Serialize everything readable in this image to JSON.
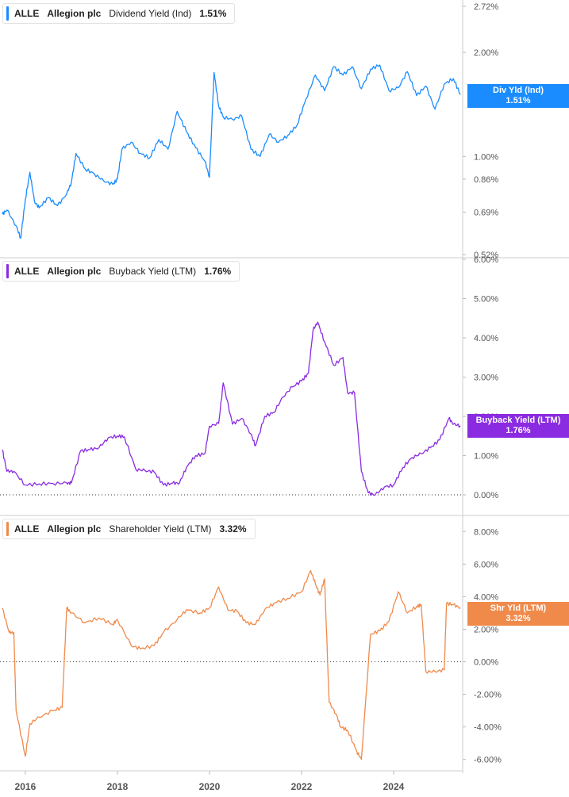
{
  "colors": {
    "dividend": "#1a8cff",
    "buyback": "#8a2be2",
    "shareholder": "#f08a4b",
    "grid": "#dddddd",
    "axis_text": "#555555"
  },
  "panels": [
    {
      "ticker": "ALLE",
      "company": "Allegion plc",
      "metric": "Dividend Yield (Ind)",
      "value": "1.51%",
      "badge_line1": "Div Yld (Ind)",
      "badge_line2": "1.51%"
    },
    {
      "ticker": "ALLE",
      "company": "Allegion plc",
      "metric": "Buyback Yield (LTM)",
      "value": "1.76%",
      "badge_line1": "Buyback Yield (LTM)",
      "badge_line2": "1.76%"
    },
    {
      "ticker": "ALLE",
      "company": "Allegion plc",
      "metric": "Shareholder Yield (LTM)",
      "value": "3.32%",
      "badge_line1": "Shr Yld (LTM)",
      "badge_line2": "3.32%"
    }
  ],
  "chart_data": [
    {
      "type": "line",
      "title": "Dividend Yield (Ind)",
      "y_scale": "log",
      "ylim": [
        0.52,
        2.72
      ],
      "y_ticks": [
        "2.72%",
        "2.00%",
        "1.00%",
        "0.86%",
        "0.69%",
        "0.52%"
      ],
      "y_tick_values": [
        2.72,
        2.0,
        1.0,
        0.86,
        0.69,
        0.52
      ],
      "series": [
        {
          "name": "Div Yld (Ind)",
          "x": [
            2015.5,
            2015.6,
            2015.8,
            2015.9,
            2016.0,
            2016.1,
            2016.2,
            2016.3,
            2016.5,
            2016.7,
            2016.9,
            2017.0,
            2017.1,
            2017.3,
            2017.5,
            2017.7,
            2017.9,
            2018.0,
            2018.1,
            2018.3,
            2018.5,
            2018.7,
            2018.9,
            2019.1,
            2019.3,
            2019.5,
            2019.7,
            2019.9,
            2020.0,
            2020.1,
            2020.2,
            2020.3,
            2020.5,
            2020.7,
            2020.9,
            2021.1,
            2021.3,
            2021.5,
            2021.7,
            2021.9,
            2022.1,
            2022.3,
            2022.5,
            2022.7,
            2022.9,
            2023.1,
            2023.3,
            2023.5,
            2023.7,
            2023.9,
            2024.1,
            2024.3,
            2024.5,
            2024.7,
            2024.9,
            2025.1,
            2025.3,
            2025.45
          ],
          "y": [
            0.68,
            0.7,
            0.63,
            0.58,
            0.75,
            0.9,
            0.74,
            0.71,
            0.76,
            0.72,
            0.78,
            0.84,
            1.02,
            0.92,
            0.89,
            0.85,
            0.83,
            0.86,
            1.05,
            1.1,
            1.02,
            0.99,
            1.12,
            1.05,
            1.35,
            1.18,
            1.06,
            0.97,
            0.87,
            1.75,
            1.4,
            1.3,
            1.28,
            1.31,
            1.05,
            1.0,
            1.16,
            1.1,
            1.15,
            1.23,
            1.47,
            1.72,
            1.55,
            1.82,
            1.72,
            1.82,
            1.57,
            1.79,
            1.84,
            1.55,
            1.58,
            1.76,
            1.5,
            1.6,
            1.37,
            1.62,
            1.68,
            1.51
          ]
        }
      ]
    },
    {
      "type": "line",
      "title": "Buyback Yield (LTM)",
      "ylim": [
        0,
        6
      ],
      "y_ticks": [
        "6.00%",
        "5.00%",
        "4.00%",
        "3.00%",
        "2.00%",
        "1.00%",
        "0.00%"
      ],
      "y_tick_values": [
        6,
        5,
        4,
        3,
        2,
        1,
        0
      ],
      "series": [
        {
          "name": "Buyback Yield (LTM)",
          "x": [
            2015.5,
            2015.6,
            2015.75,
            2016.0,
            2016.3,
            2016.6,
            2016.9,
            2017.0,
            2017.2,
            2017.4,
            2017.6,
            2017.8,
            2018.0,
            2018.15,
            2018.4,
            2018.6,
            2018.8,
            2019.0,
            2019.2,
            2019.35,
            2019.5,
            2019.7,
            2019.9,
            2020.0,
            2020.2,
            2020.3,
            2020.5,
            2020.7,
            2020.9,
            2021.0,
            2021.2,
            2021.4,
            2021.6,
            2021.8,
            2022.0,
            2022.15,
            2022.25,
            2022.35,
            2022.5,
            2022.7,
            2022.9,
            2023.0,
            2023.15,
            2023.3,
            2023.45,
            2023.6,
            2023.8,
            2024.0,
            2024.2,
            2024.4,
            2024.6,
            2024.8,
            2025.0,
            2025.2,
            2025.3,
            2025.45
          ],
          "y": [
            1.15,
            0.6,
            0.6,
            0.25,
            0.28,
            0.29,
            0.3,
            0.3,
            1.12,
            1.15,
            1.2,
            1.45,
            1.5,
            1.48,
            0.65,
            0.62,
            0.58,
            0.25,
            0.3,
            0.3,
            0.7,
            1.0,
            1.05,
            1.75,
            1.82,
            2.85,
            1.8,
            1.95,
            1.55,
            1.25,
            2.0,
            2.1,
            2.5,
            2.75,
            2.9,
            3.1,
            4.2,
            4.4,
            3.9,
            3.3,
            3.5,
            2.6,
            2.6,
            0.6,
            0.05,
            0.0,
            0.2,
            0.25,
            0.7,
            0.95,
            1.05,
            1.2,
            1.4,
            1.95,
            1.8,
            1.76
          ]
        }
      ]
    },
    {
      "type": "line",
      "title": "Shareholder Yield (LTM)",
      "ylim": [
        -6.5,
        8.5
      ],
      "y_ticks": [
        "8.00%",
        "6.00%",
        "4.00%",
        "2.00%",
        "0.00%",
        "-2.00%",
        "-4.00%",
        "-6.00%"
      ],
      "y_tick_values": [
        8,
        6,
        4,
        2,
        0,
        -2,
        -4,
        -6
      ],
      "series": [
        {
          "name": "Shr Yld (LTM)",
          "x": [
            2015.5,
            2015.65,
            2015.75,
            2015.8,
            2016.0,
            2016.1,
            2016.3,
            2016.6,
            2016.8,
            2016.9,
            2017.0,
            2017.3,
            2017.6,
            2017.9,
            2018.0,
            2018.3,
            2018.5,
            2018.8,
            2019.0,
            2019.3,
            2019.5,
            2019.8,
            2020.0,
            2020.2,
            2020.4,
            2020.6,
            2020.8,
            2021.0,
            2021.2,
            2021.4,
            2021.7,
            2022.0,
            2022.2,
            2022.3,
            2022.4,
            2022.5,
            2022.6,
            2022.75,
            2022.85,
            2023.0,
            2023.2,
            2023.3,
            2023.5,
            2023.7,
            2023.9,
            2024.1,
            2024.3,
            2024.5,
            2024.6,
            2024.7,
            2024.9,
            2025.1,
            2025.15,
            2025.3,
            2025.45
          ],
          "y": [
            3.3,
            1.8,
            1.8,
            -3.0,
            -5.8,
            -3.8,
            -3.4,
            -3.0,
            -2.8,
            3.3,
            3.0,
            2.4,
            2.7,
            2.3,
            2.6,
            1.0,
            0.8,
            1.0,
            1.8,
            2.6,
            3.2,
            3.0,
            3.3,
            4.6,
            3.2,
            3.1,
            2.4,
            2.3,
            3.2,
            3.6,
            3.9,
            4.3,
            5.6,
            4.8,
            4.1,
            5.1,
            -2.5,
            -3.2,
            -4.0,
            -4.2,
            -5.5,
            -6.0,
            1.7,
            1.9,
            2.5,
            4.3,
            3.0,
            3.4,
            3.5,
            -0.6,
            -0.6,
            -0.5,
            3.6,
            3.5,
            3.32
          ]
        }
      ]
    }
  ],
  "x_axis": {
    "labels": [
      "2016",
      "2018",
      "2020",
      "2022",
      "2024"
    ],
    "label_values": [
      2016,
      2018,
      2020,
      2022,
      2024
    ],
    "xlim": [
      2015.45,
      2025.5
    ]
  }
}
